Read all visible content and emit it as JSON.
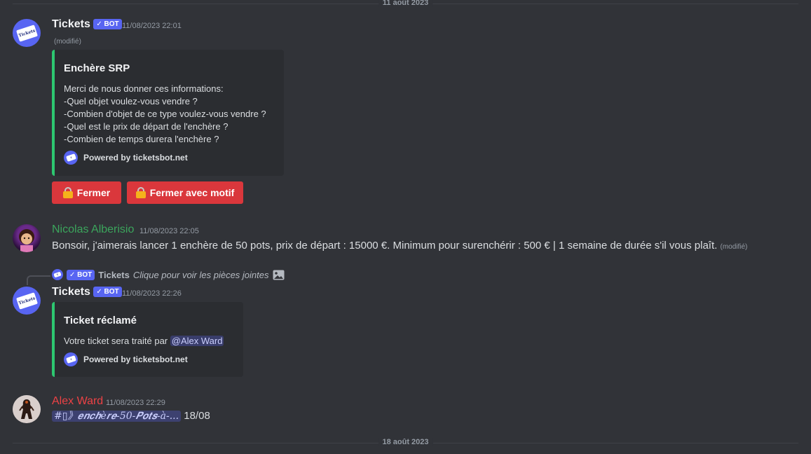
{
  "dividers": {
    "top": "11 août 2023",
    "bottom": "18 août 2023"
  },
  "msg1": {
    "author": "Tickets",
    "bot_tag": "✓ BOT",
    "timestamp": "11/08/2023 22:01",
    "edited": "(modifié)",
    "embed": {
      "title": "Enchère SRP",
      "lines": [
        "Merci de nous donner ces informations:",
        "-Quel objet voulez-vous vendre ?",
        "-Combien d'objet de ce type voulez-vous vendre ?",
        "-Quel est le prix de départ de l'enchère ?",
        "-Combien de temps durera l'enchère ?"
      ],
      "footer": "Powered by ticketsbot.net"
    },
    "buttons": [
      "Fermer",
      "Fermer avec motif"
    ]
  },
  "msg2": {
    "author": "Nicolas Alberisio",
    "author_color": "#3ba55c",
    "timestamp": "11/08/2023 22:05",
    "text": "Bonsoir, j'aimerais lancer 1 enchère de 50 pots, prix de départ : 15000 €. Minimum pour surenchérir : 500 € | 1 semaine de durée s'il vous plaît.",
    "edited": "(modifié)"
  },
  "msg3": {
    "reply": {
      "bot_tag": "✓ BOT",
      "author": "Tickets",
      "text": "Clique pour voir les pièces jointes"
    },
    "author": "Tickets",
    "bot_tag": "✓ BOT",
    "timestamp": "11/08/2023 22:26",
    "embed": {
      "title": "Ticket réclamé",
      "desc": "Votre ticket sera traité par",
      "mention": "@Alex Ward",
      "footer": "Powered by ticketsbot.net"
    }
  },
  "msg4": {
    "author": "Alex Ward",
    "author_color": "#ed4245",
    "timestamp": "11/08/2023 22:29",
    "channel": "#▯》𝒆𝒏𝒄𝒉è𝒓𝒆-50-𝑷𝒐𝒕𝒔-à-...",
    "text": "18/08"
  },
  "icons": {
    "bot_avatar": "ticket-icon",
    "lock": "lock-icon",
    "image": "image-icon"
  },
  "colors": {
    "accent": "#5865f2",
    "embed_bar": "#2dc770",
    "danger": "#da373c"
  }
}
